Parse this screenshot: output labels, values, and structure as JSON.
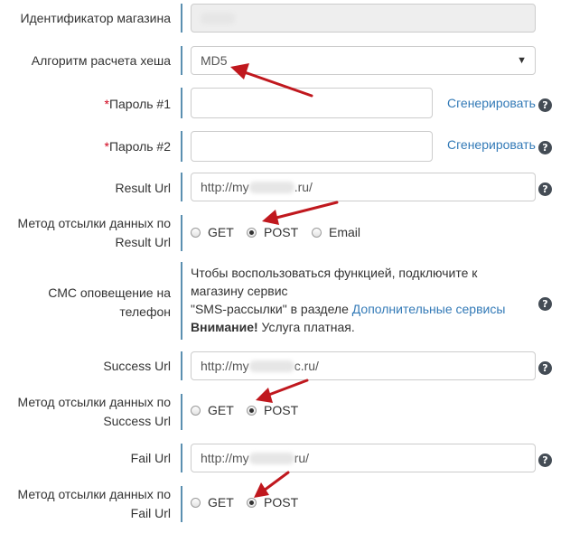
{
  "form": {
    "shop_id": {
      "label": "Идентификатор магазина"
    },
    "hash_algo": {
      "label": "Алгоритм расчета хеша",
      "value": "MD5"
    },
    "password1": {
      "required_mark": "*",
      "label": "Пароль #1",
      "generate": "Сгенерировать"
    },
    "password2": {
      "required_mark": "*",
      "label": "Пароль #2",
      "generate": "Сгенерировать"
    },
    "result_url": {
      "label": "Result Url",
      "value_prefix": "http://my",
      "value_suffix": ".ru/"
    },
    "result_method": {
      "label_line1": "Метод отсылки данных по",
      "label_line2": "Result Url",
      "options": [
        "GET",
        "POST",
        "Email"
      ],
      "selected": "POST"
    },
    "sms": {
      "label_line1": "СМС оповещение на",
      "label_line2": "телефон",
      "text_line1": "Чтобы воспользоваться функцией, подключите к",
      "text_line2": "магазину сервис",
      "text_line3_quote": "\"SMS-рассылки\" в разделе ",
      "text_line3_link": "Дополнительные сервисы",
      "warning_bold": "Внимание!",
      "warning_text": " Услуга платная."
    },
    "success_url": {
      "label": "Success Url",
      "value_prefix": "http://my",
      "value_suffix": "c.ru/"
    },
    "success_method": {
      "label_line1": "Метод отсылки данных по",
      "label_line2": "Success Url",
      "options": [
        "GET",
        "POST"
      ],
      "selected": "POST"
    },
    "fail_url": {
      "label": "Fail Url",
      "value_prefix": "http://my",
      "value_suffix": "ru/"
    },
    "fail_method": {
      "label_line1": "Метод отсылки данных по",
      "label_line2": "Fail Url",
      "options": [
        "GET",
        "POST"
      ],
      "selected": "POST"
    },
    "help_glyph": "?"
  },
  "colors": {
    "link": "#337ab7",
    "accent_bar": "#5a8fb0",
    "arrow": "#c0181e",
    "required": "#d0021b"
  }
}
